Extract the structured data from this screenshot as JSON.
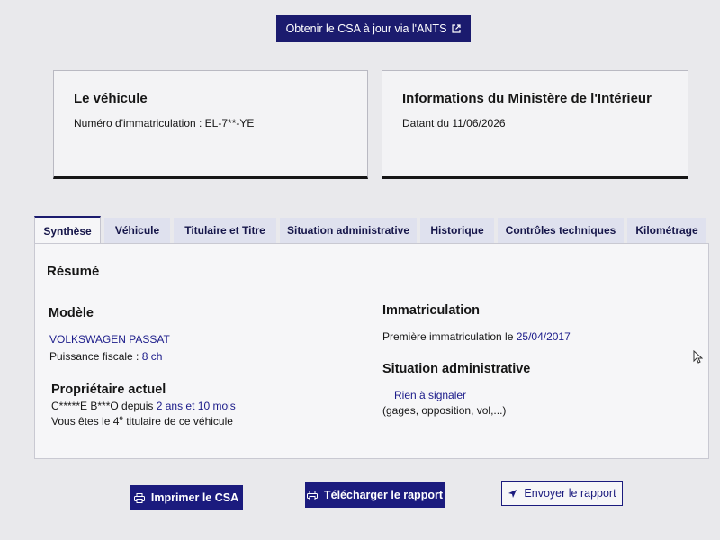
{
  "top_button": {
    "label": "Obtenir le CSA à jour via l'ANTS",
    "icon": "external-link-icon"
  },
  "vehicle_card": {
    "title": "Le véhicule",
    "plate_label": "Numéro d'immatriculation : ",
    "plate_value": "EL-7**-YE"
  },
  "ministry_card": {
    "title": "Informations du Ministère de l'Intérieur",
    "date_text": "Datant du 11/06/2026"
  },
  "tabs": [
    {
      "label": "Synthèse",
      "active": true
    },
    {
      "label": "Véhicule"
    },
    {
      "label": "Titulaire et Titre"
    },
    {
      "label": "Situation administrative"
    },
    {
      "label": "Historique"
    },
    {
      "label": "Contrôles techniques"
    },
    {
      "label": "Kilométrage"
    }
  ],
  "summary": {
    "title": "Résumé",
    "model": {
      "heading": "Modèle",
      "name": "VOLKSWAGEN PASSAT",
      "power_label": "Puissance fiscale : ",
      "power_value": "8 ch"
    },
    "owner": {
      "heading": "Propriétaire actuel",
      "name": "C*****E B***O",
      "since_label": " depuis ",
      "since_value": "2 ans et 10 mois",
      "rank_prefix": "Vous êtes le ",
      "rank_number": "4",
      "rank_sup": "e",
      "rank_suffix": " titulaire de ce véhicule"
    },
    "registration": {
      "heading": "Immatriculation",
      "first_label": "Première immatriculation le ",
      "first_date": "25/04/2017"
    },
    "admin": {
      "heading": "Situation administrative",
      "status": "Rien à signaler",
      "detail": "(gages, opposition, vol,...)"
    }
  },
  "actions": {
    "print_label": "Imprimer le CSA",
    "download_label": "Télécharger le rapport",
    "send_label": "Envoyer le rapport"
  },
  "colors": {
    "primary": "#1b1b7e",
    "tab_bg": "#dfe1ee",
    "panel_bg": "#f6f6f8"
  }
}
